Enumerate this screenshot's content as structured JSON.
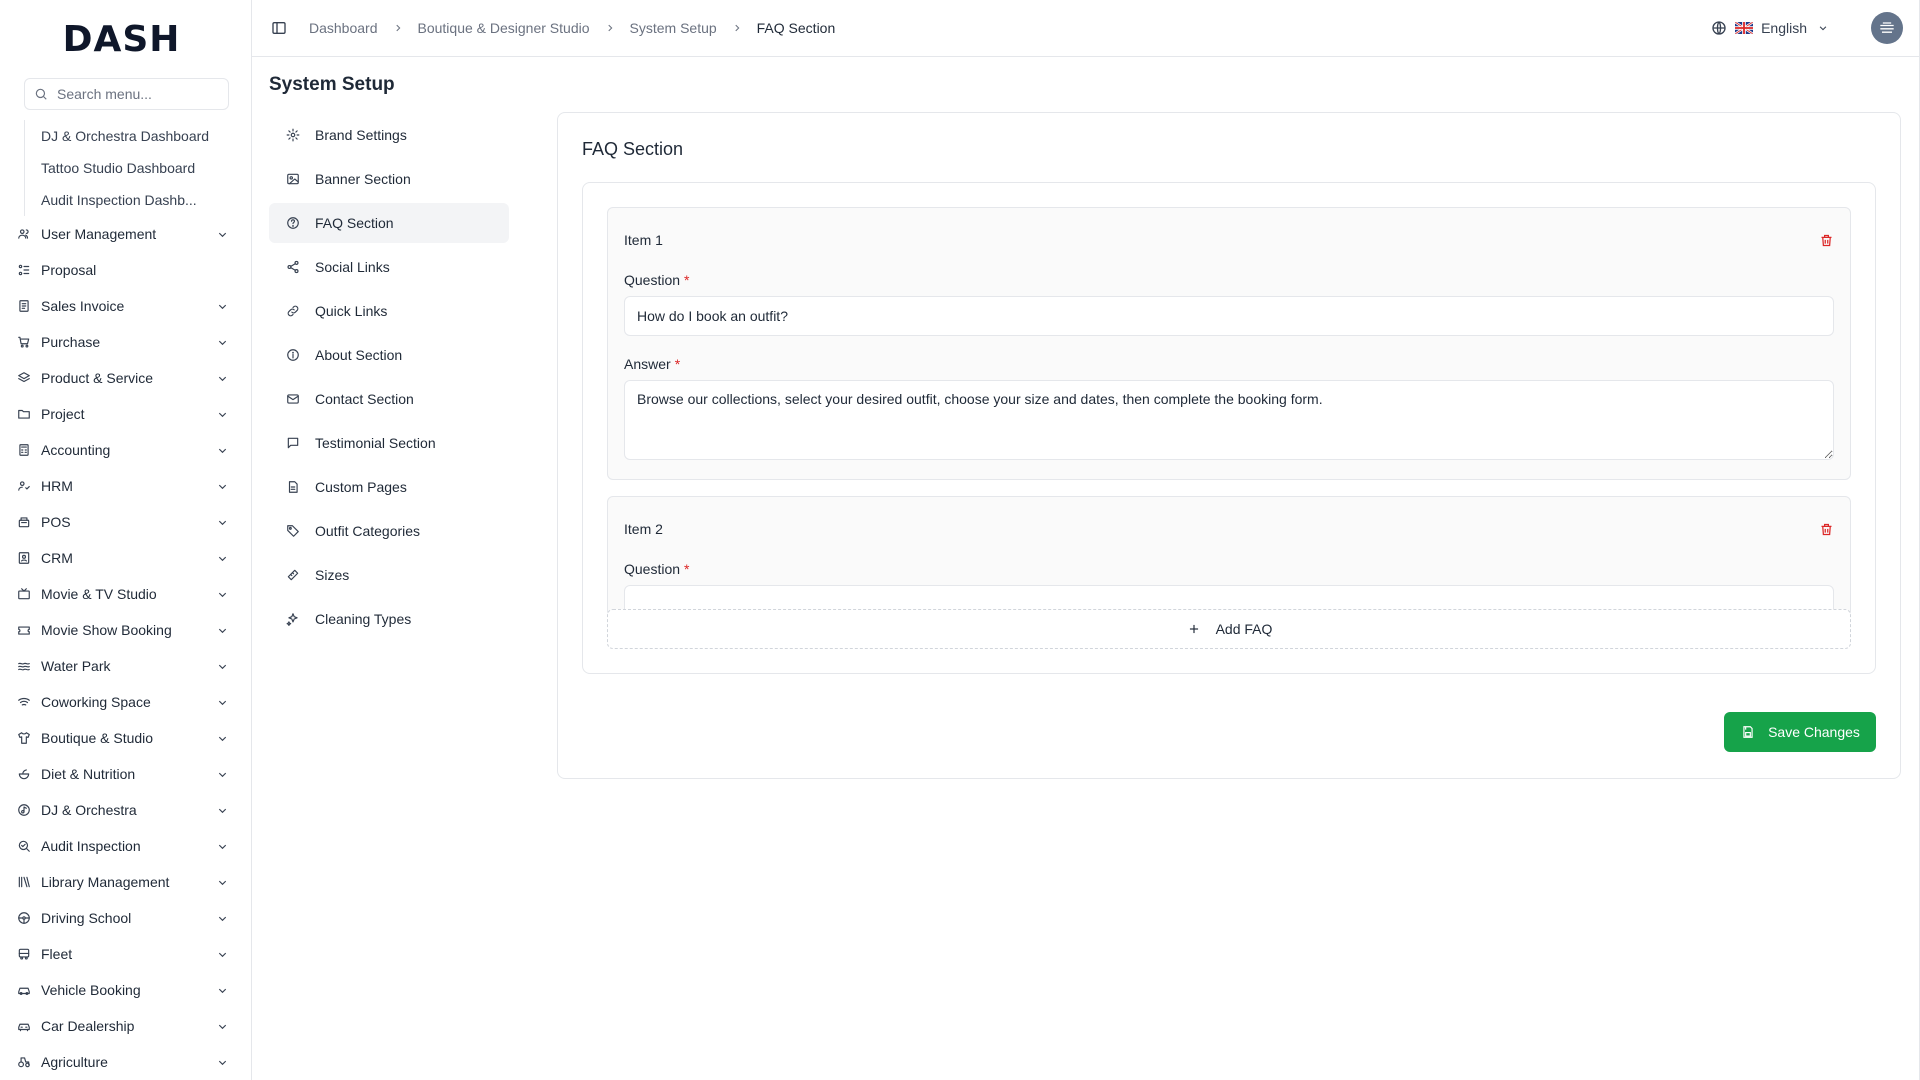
{
  "app": {
    "logo": "DASH"
  },
  "sidebar": {
    "search_placeholder": "Search menu...",
    "subitems": [
      "DJ & Orchestra Dashboard",
      "Tattoo Studio Dashboard",
      "Audit Inspection Dashb..."
    ],
    "items": [
      {
        "label": "User Management",
        "icon": "users-icon",
        "has_children": true
      },
      {
        "label": "Proposal",
        "icon": "proposal-icon",
        "has_children": false
      },
      {
        "label": "Sales Invoice",
        "icon": "invoice-icon",
        "has_children": true
      },
      {
        "label": "Purchase",
        "icon": "cart-icon",
        "has_children": true
      },
      {
        "label": "Product & Service",
        "icon": "layers-icon",
        "has_children": true
      },
      {
        "label": "Project",
        "icon": "folder-icon",
        "has_children": true
      },
      {
        "label": "Accounting",
        "icon": "calculator-icon",
        "has_children": true
      },
      {
        "label": "HRM",
        "icon": "person-icon",
        "has_children": true
      },
      {
        "label": "POS",
        "icon": "register-icon",
        "has_children": true
      },
      {
        "label": "CRM",
        "icon": "contact-icon",
        "has_children": true
      },
      {
        "label": "Movie & TV Studio",
        "icon": "tv-icon",
        "has_children": true
      },
      {
        "label": "Movie Show Booking",
        "icon": "ticket-icon",
        "has_children": true
      },
      {
        "label": "Water Park",
        "icon": "waves-icon",
        "has_children": true
      },
      {
        "label": "Coworking Space",
        "icon": "wifi-icon",
        "has_children": true
      },
      {
        "label": "Boutique & Studio",
        "icon": "shirt-icon",
        "has_children": true
      },
      {
        "label": "Diet & Nutrition",
        "icon": "salad-icon",
        "has_children": true
      },
      {
        "label": "DJ & Orchestra",
        "icon": "music-icon",
        "has_children": true
      },
      {
        "label": "Audit Inspection",
        "icon": "search-check-icon",
        "has_children": true
      },
      {
        "label": "Library Management",
        "icon": "books-icon",
        "has_children": true
      },
      {
        "label": "Driving School",
        "icon": "steering-icon",
        "has_children": true
      },
      {
        "label": "Fleet",
        "icon": "bus-icon",
        "has_children": true
      },
      {
        "label": "Vehicle Booking",
        "icon": "car-icon",
        "has_children": true
      },
      {
        "label": "Car Dealership",
        "icon": "car-front-icon",
        "has_children": true
      },
      {
        "label": "Agriculture",
        "icon": "tractor-icon",
        "has_children": true
      }
    ]
  },
  "topbar": {
    "breadcrumbs": [
      "Dashboard",
      "Boutique & Designer Studio",
      "System Setup",
      "FAQ Section"
    ],
    "language": "English"
  },
  "page": {
    "title": "System Setup"
  },
  "setup_menu": [
    {
      "label": "Brand Settings",
      "icon": "gear-icon",
      "active": false
    },
    {
      "label": "Banner Section",
      "icon": "image-icon",
      "active": false
    },
    {
      "label": "FAQ Section",
      "icon": "help-circle-icon",
      "active": true
    },
    {
      "label": "Social Links",
      "icon": "share-icon",
      "active": false
    },
    {
      "label": "Quick Links",
      "icon": "link-icon",
      "active": false
    },
    {
      "label": "About Section",
      "icon": "info-icon",
      "active": false
    },
    {
      "label": "Contact Section",
      "icon": "mail-icon",
      "active": false
    },
    {
      "label": "Testimonial Section",
      "icon": "message-icon",
      "active": false
    },
    {
      "label": "Custom Pages",
      "icon": "file-icon",
      "active": false
    },
    {
      "label": "Outfit Categories",
      "icon": "tag-icon",
      "active": false
    },
    {
      "label": "Sizes",
      "icon": "ruler-icon",
      "active": false
    },
    {
      "label": "Cleaning Types",
      "icon": "sparkle-icon",
      "active": false
    }
  ],
  "faq": {
    "title": "FAQ Section",
    "items": [
      {
        "label": "Item 1",
        "question_label": "Question",
        "question_value": "How do I book an outfit?",
        "answer_label": "Answer",
        "answer_value": "Browse our collections, select your desired outfit, choose your size and dates, then complete the booking form."
      },
      {
        "label": "Item 2",
        "question_label": "Question"
      }
    ],
    "add_label": "Add FAQ",
    "save_label": "Save Changes"
  },
  "colors": {
    "accent": "#16a34a",
    "danger": "#dc2626"
  }
}
